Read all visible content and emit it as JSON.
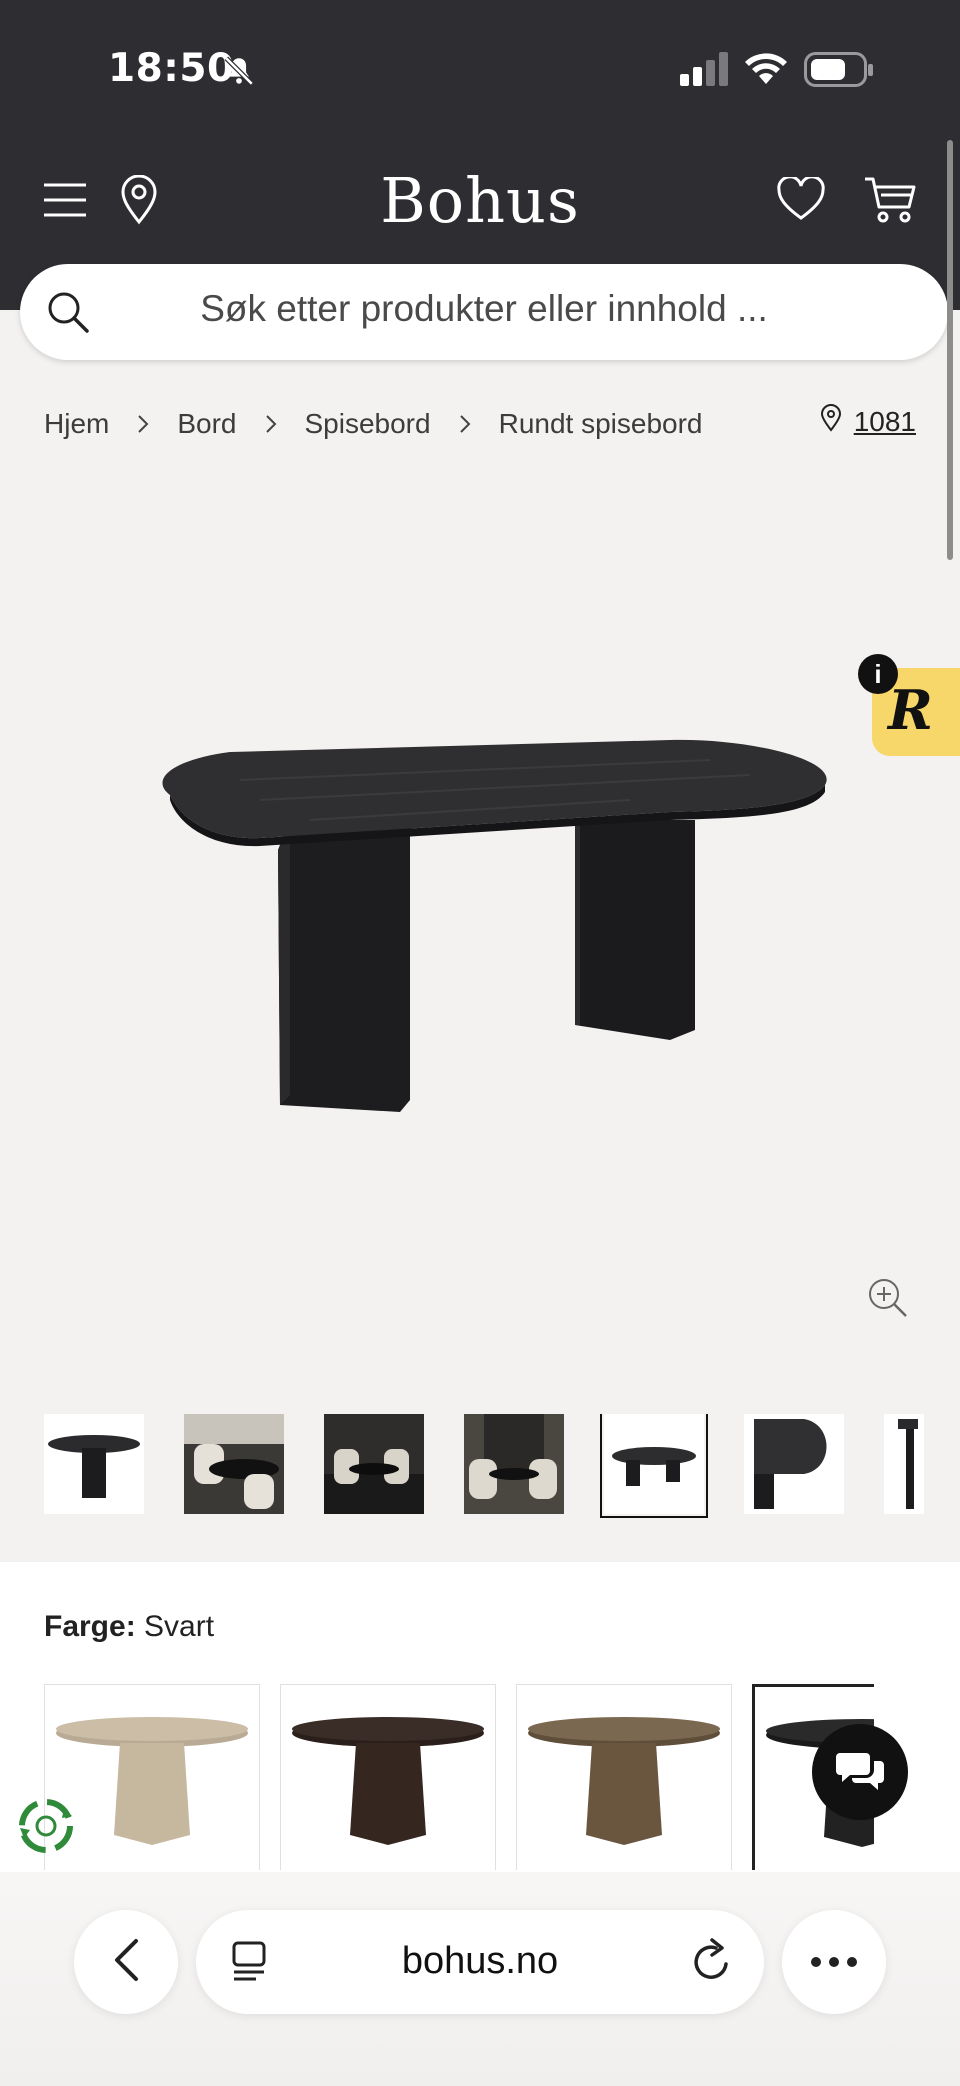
{
  "status": {
    "time": "18:50"
  },
  "header": {
    "logo": "Bohus"
  },
  "search": {
    "placeholder": "Søk etter produkter eller innhold ..."
  },
  "breadcrumb": {
    "items": [
      "Hjem",
      "Bord",
      "Spisebord",
      "Rundt spisebord"
    ]
  },
  "location": {
    "code": "1081"
  },
  "badge": {
    "letter": "R",
    "info": "i"
  },
  "product": {
    "color_label": "Farge:",
    "color_value": "Svart"
  },
  "browser": {
    "url": "bohus.no"
  },
  "colors": {
    "header_bg": "#2e2d32",
    "page_bg": "#f4f2f0",
    "badge_yellow": "#f7d66a"
  }
}
